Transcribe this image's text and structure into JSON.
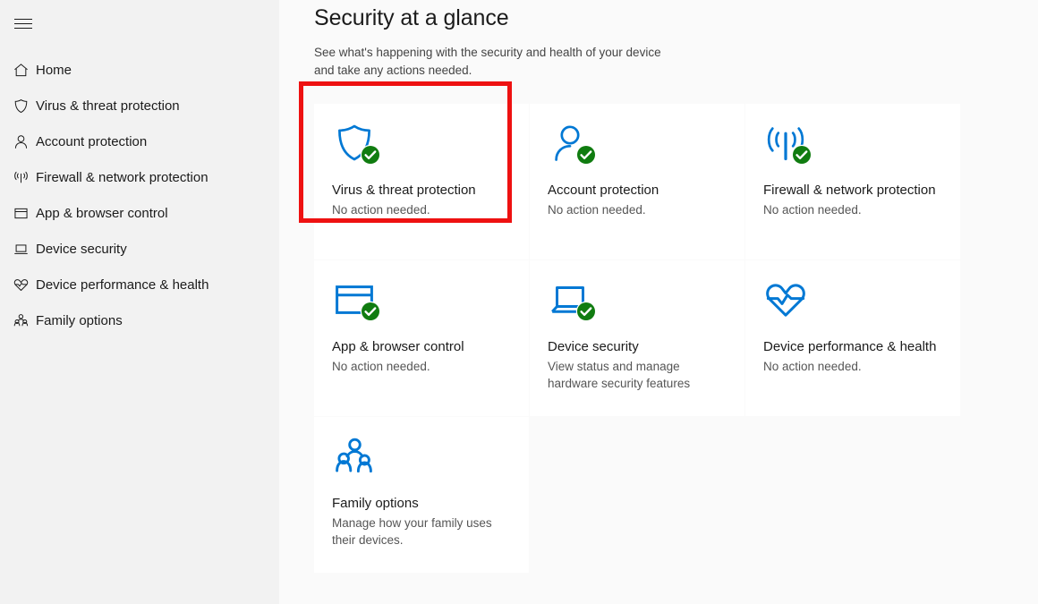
{
  "sidebar": {
    "menu_button": {
      "name": "hamburger-menu",
      "label": "Menu"
    },
    "items": [
      {
        "icon": "home-icon",
        "label": "Home"
      },
      {
        "icon": "shield-icon",
        "label": "Virus & threat protection"
      },
      {
        "icon": "person-icon",
        "label": "Account protection"
      },
      {
        "icon": "wifi-firewall-icon",
        "label": "Firewall & network protection"
      },
      {
        "icon": "browser-window-icon",
        "label": "App & browser control"
      },
      {
        "icon": "laptop-icon",
        "label": "Device security"
      },
      {
        "icon": "heart-pulse-icon",
        "label": "Device performance & health"
      },
      {
        "icon": "family-group-icon",
        "label": "Family options"
      }
    ]
  },
  "header": {
    "title": "Security at a glance",
    "subtitle": "See what's happening with the security and health of your device and take any actions needed."
  },
  "tiles": [
    {
      "icon": "shield-icon",
      "title": "Virus & threat protection",
      "status": "No action needed.",
      "badge": "green-check-badge",
      "highlighted": true
    },
    {
      "icon": "person-icon",
      "title": "Account protection",
      "status": "No action needed.",
      "badge": "green-check-badge",
      "highlighted": false
    },
    {
      "icon": "wifi-firewall-icon",
      "title": "Firewall & network protection",
      "status": "No action needed.",
      "badge": "green-check-badge",
      "highlighted": false
    },
    {
      "icon": "browser-window-icon",
      "title": "App & browser control",
      "status": "No action needed.",
      "badge": "green-check-badge",
      "highlighted": false
    },
    {
      "icon": "laptop-icon",
      "title": "Device security",
      "status": "View status and manage hardware security features",
      "badge": "green-check-badge",
      "highlighted": false
    },
    {
      "icon": "heart-pulse-icon",
      "title": "Device performance & health",
      "status": "No action needed.",
      "badge": null,
      "highlighted": false
    },
    {
      "icon": "family-group-icon",
      "title": "Family options",
      "status": "Manage how your family uses their devices.",
      "badge": null,
      "highlighted": false
    }
  ],
  "colors": {
    "accent_blue": "#0078d4",
    "status_green": "#107c10",
    "highlight_red": "#ee1111",
    "sidebar_bg": "#f2f2f2",
    "main_bg": "#fafafa",
    "tile_bg": "#ffffff",
    "text_primary": "#1b1b1b",
    "text_secondary": "#555555"
  }
}
